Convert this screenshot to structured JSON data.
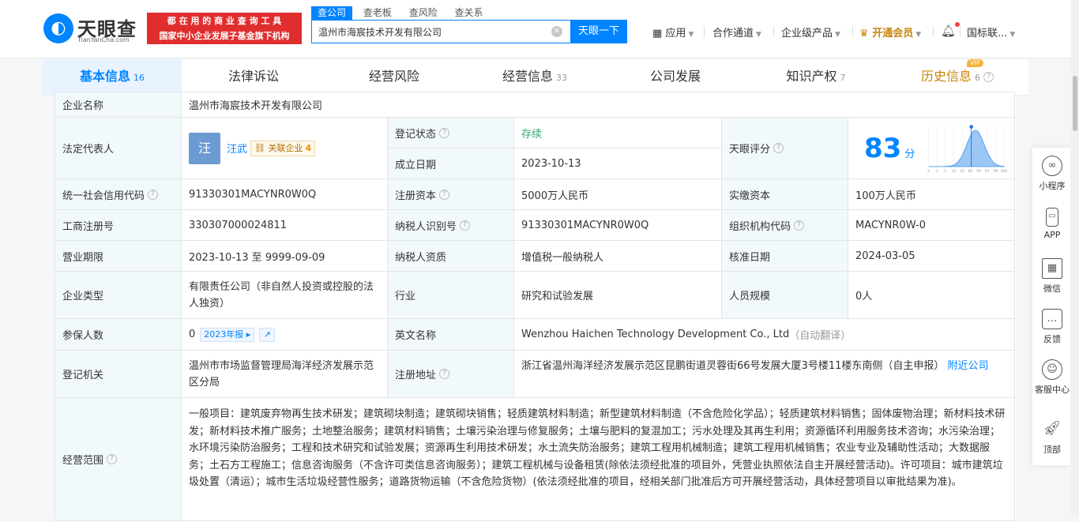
{
  "header": {
    "logo_text": "天眼查",
    "logo_sub": "TianYanCha.com",
    "banner_line1": "都 在 用 的 商 业 查 询 工 具",
    "banner_line2": "国家中小企业发展子基金旗下机构",
    "search_tabs": [
      "查公司",
      "查老板",
      "查风险",
      "查关系"
    ],
    "search_value": "温州市海宸技术开发有限公司",
    "search_button": "天眼一下",
    "nav": {
      "apps": "应用",
      "channel": "合作通道",
      "enterprise": "企业级产品",
      "vip": "开通会员",
      "user": "国标联..."
    }
  },
  "tabs": [
    {
      "label": "基本信息",
      "count": "16"
    },
    {
      "label": "法律诉讼",
      "count": ""
    },
    {
      "label": "经营风险",
      "count": ""
    },
    {
      "label": "经营信息",
      "count": "33"
    },
    {
      "label": "公司发展",
      "count": ""
    },
    {
      "label": "知识产权",
      "count": "7"
    },
    {
      "label": "历史信息",
      "count": "6",
      "tag": "VIP"
    }
  ],
  "info": {
    "company_name_label": "企业名称",
    "company_name": "温州市海宸技术开发有限公司",
    "legal_rep_label": "法定代表人",
    "legal_rep_avatar": "汪",
    "legal_rep": "汪武",
    "related_label": "关联企业",
    "related_count": "4",
    "reg_status_label": "登记状态",
    "reg_status": "存续",
    "est_date_label": "成立日期",
    "est_date": "2023-10-13",
    "score_label": "天眼评分",
    "score": "83",
    "score_unit": "分",
    "credit_code_label": "统一社会信用代码",
    "credit_code": "91330301MACYNR0W0Q",
    "reg_capital_label": "注册资本",
    "reg_capital": "5000万人民币",
    "paid_capital_label": "实缴资本",
    "paid_capital": "100万人民币",
    "biz_reg_label": "工商注册号",
    "biz_reg": "330307000024811",
    "taxpayer_id_label": "纳税人识别号",
    "taxpayer_id": "91330301MACYNR0W0Q",
    "org_code_label": "组织机构代码",
    "org_code": "MACYNR0W-0",
    "term_label": "营业期限",
    "term": "2023-10-13 至 9999-09-09",
    "taxpayer_q_label": "纳税人资质",
    "taxpayer_q": "增值税一般纳税人",
    "approve_label": "核准日期",
    "approve": "2024-03-05",
    "type_label": "企业类型",
    "type": "有限责任公司（非自然人投资或控股的法人独资）",
    "industry_label": "行业",
    "industry": "研究和试验发展",
    "staff_label": "人员规模",
    "staff": "0人",
    "insured_label": "参保人数",
    "insured": "0",
    "report_badge": "2023年报",
    "en_name_label": "英文名称",
    "en_name": "Wenzhou Haichen Technology Development Co., Ltd",
    "auto_translate": "（自动翻译）",
    "authority_label": "登记机关",
    "authority": "温州市市场监督管理局海洋经济发展示范区分局",
    "address_label": "注册地址",
    "address": "浙江省温州海洋经济发展示范区昆鹏街道灵蓉街66号发展大厦3号楼11楼东南侧（自主申报）",
    "nearby": "附近公司",
    "scope_label": "经营范围",
    "scope": "一般项目：建筑废弃物再生技术研发；建筑砌块制造；建筑砌块销售；轻质建筑材料制造；新型建筑材料制造（不含危险化学品）；轻质建筑材料销售；固体废物治理；新材料技术研发；新材料技术推广服务；土地整治服务；建筑材料销售；土壤污染治理与修复服务；土壤与肥料的复混加工；污水处理及其再生利用；资源循环利用服务技术咨询；水污染治理；水环境污染防治服务；工程和技术研究和试验发展；资源再生利用技术研发；水土流失防治服务；建筑工程用机械制造；建筑工程用机械销售；农业专业及辅助性活动；大数据服务；土石方工程施工；信息咨询服务（不含许可类信息咨询服务）；建筑工程机械与设备租赁(除依法须经批准的项目外，凭营业执照依法自主开展经营活动)。许可项目：城市建筑垃圾处置（清运）；城市生活垃圾经营性服务；道路货物运输（不含危险货物）(依法须经批准的项目，经相关部门批准后方可开展经营活动，具体经营项目以审批结果为准)。"
  },
  "score_chart": {
    "x": [
      "0",
      "1",
      "5",
      "15",
      "50",
      "85",
      "95",
      "97",
      "99",
      "100"
    ],
    "marker": "83"
  },
  "sidebar": [
    "小程序",
    "APP",
    "微信",
    "反馈",
    "客服中心",
    "顶部"
  ],
  "colors": {
    "accent": "#0084ff",
    "banner": "#e02e2e",
    "label_bg": "#f2f9fc",
    "vip": "#c8850a",
    "status": "#2fa86a"
  }
}
